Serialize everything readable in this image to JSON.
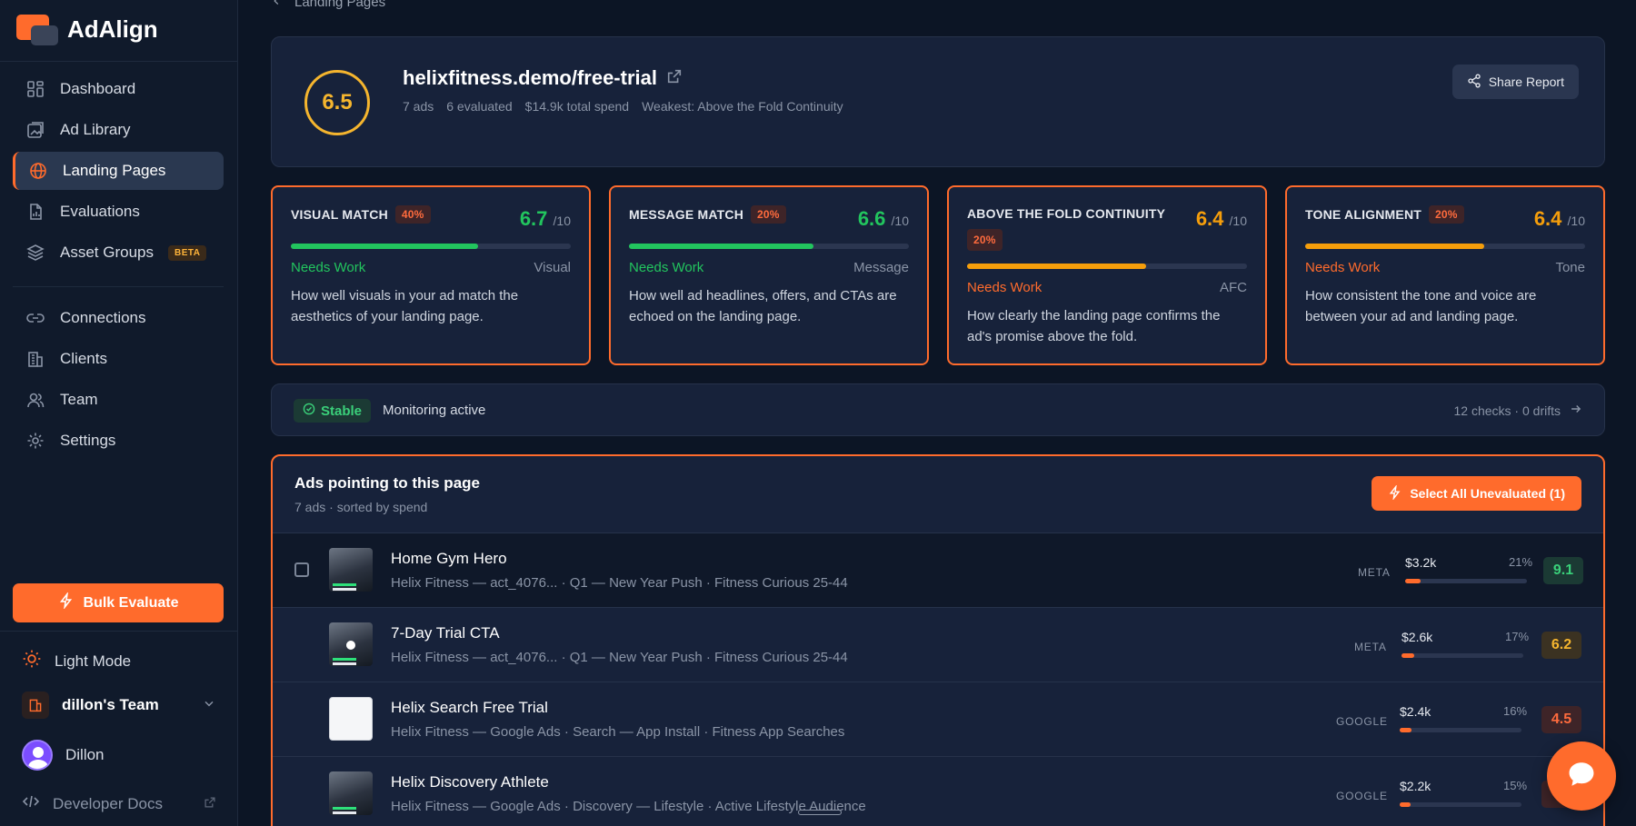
{
  "app": {
    "name": "AdAlign",
    "accent": "#ff6b2c"
  },
  "sidebar": {
    "nav": [
      {
        "label": "Dashboard",
        "icon": "grid-icon"
      },
      {
        "label": "Ad Library",
        "icon": "image-icon"
      },
      {
        "label": "Landing Pages",
        "icon": "globe-icon",
        "active": true
      },
      {
        "label": "Evaluations",
        "icon": "document-icon"
      },
      {
        "label": "Asset Groups",
        "icon": "layers-icon",
        "badge": "BETA"
      }
    ],
    "nav2": [
      {
        "label": "Connections",
        "icon": "link-icon"
      },
      {
        "label": "Clients",
        "icon": "building-icon"
      },
      {
        "label": "Team",
        "icon": "users-icon"
      },
      {
        "label": "Settings",
        "icon": "gear-icon"
      }
    ],
    "bulk_evaluate": "Bulk Evaluate",
    "light_mode": "Light Mode",
    "team_name": "dillon's Team",
    "user_name": "Dillon",
    "developer_docs": "Developer Docs"
  },
  "breadcrumb": {
    "back_label": "Landing Pages"
  },
  "summary": {
    "score": "6.5",
    "url": "helixfitness.demo/free-trial",
    "ads": "7 ads",
    "evaluated": "6 evaluated",
    "spend": "$14.9k total spend",
    "weakest": "Weakest: Above the Fold Continuity",
    "share_label": "Share Report"
  },
  "metrics": [
    {
      "title": "VISUAL MATCH",
      "weight": "40%",
      "score": "6.7",
      "out_of": "/10",
      "status": "Needs Work",
      "category": "Visual",
      "fill": 0.67,
      "color": "#22c55e",
      "description": "How well visuals in your ad match the aesthetics of your landing page."
    },
    {
      "title": "MESSAGE MATCH",
      "weight": "20%",
      "score": "6.6",
      "out_of": "/10",
      "status": "Needs Work",
      "category": "Message",
      "fill": 0.66,
      "color": "#22c55e",
      "description": "How well ad headlines, offers, and CTAs are echoed on the landing page."
    },
    {
      "title": "ABOVE THE FOLD CONTINUITY",
      "weight": "20%",
      "score": "6.4",
      "out_of": "/10",
      "status": "Needs Work",
      "category": "AFC",
      "fill": 0.64,
      "color": "#f59e0b",
      "description": "How clearly the landing page confirms the ad's promise above the fold."
    },
    {
      "title": "TONE ALIGNMENT",
      "weight": "20%",
      "score": "6.4",
      "out_of": "/10",
      "status": "Needs Work",
      "category": "Tone",
      "fill": 0.64,
      "color": "#f59e0b",
      "description": "How consistent the tone and voice are between your ad and landing page."
    }
  ],
  "monitor": {
    "badge": "Stable",
    "text": "Monitoring active",
    "checks": "12 checks · 0 drifts"
  },
  "ads": {
    "title": "Ads pointing to this page",
    "subtitle": "7 ads · sorted by spend",
    "select_label": "Select All Unevaluated (1)",
    "rows": [
      {
        "name": "Home Gym Hero",
        "sub": "Helix Fitness — act_4076... · Q1 — New Year Push · Fitness Curious 25-44",
        "platform": "META",
        "spend": "$3.2k",
        "share": "21%",
        "share_frac": 0.21,
        "score": "9.1",
        "score_color": "#3ad07a",
        "score_bg": "#1b3a34"
      },
      {
        "name": "7-Day Trial CTA",
        "sub": "Helix Fitness — act_4076... · Q1 — New Year Push · Fitness Curious 25-44",
        "platform": "META",
        "spend": "$2.6k",
        "share": "17%",
        "share_frac": 0.17,
        "score": "6.2",
        "score_color": "#f5b52e",
        "score_bg": "#3b3222"
      },
      {
        "name": "Helix Search Free Trial",
        "sub": "Helix Fitness — Google Ads · Search — App Install · Fitness App Searches",
        "platform": "GOOGLE",
        "spend": "$2.4k",
        "share": "16%",
        "share_frac": 0.16,
        "score": "4.5",
        "score_color": "#ff6b3d",
        "score_bg": "#3e2428"
      },
      {
        "name": "Helix Discovery Athlete",
        "sub": "Helix Fitness — Google Ads · Discovery — Lifestyle · Active Lifestyle Audience",
        "platform": "GOOGLE",
        "spend": "$2.2k",
        "share": "15%",
        "share_frac": 0.15,
        "score": "",
        "score_color": "#ff6b3d",
        "score_bg": "#3e2428"
      }
    ]
  }
}
